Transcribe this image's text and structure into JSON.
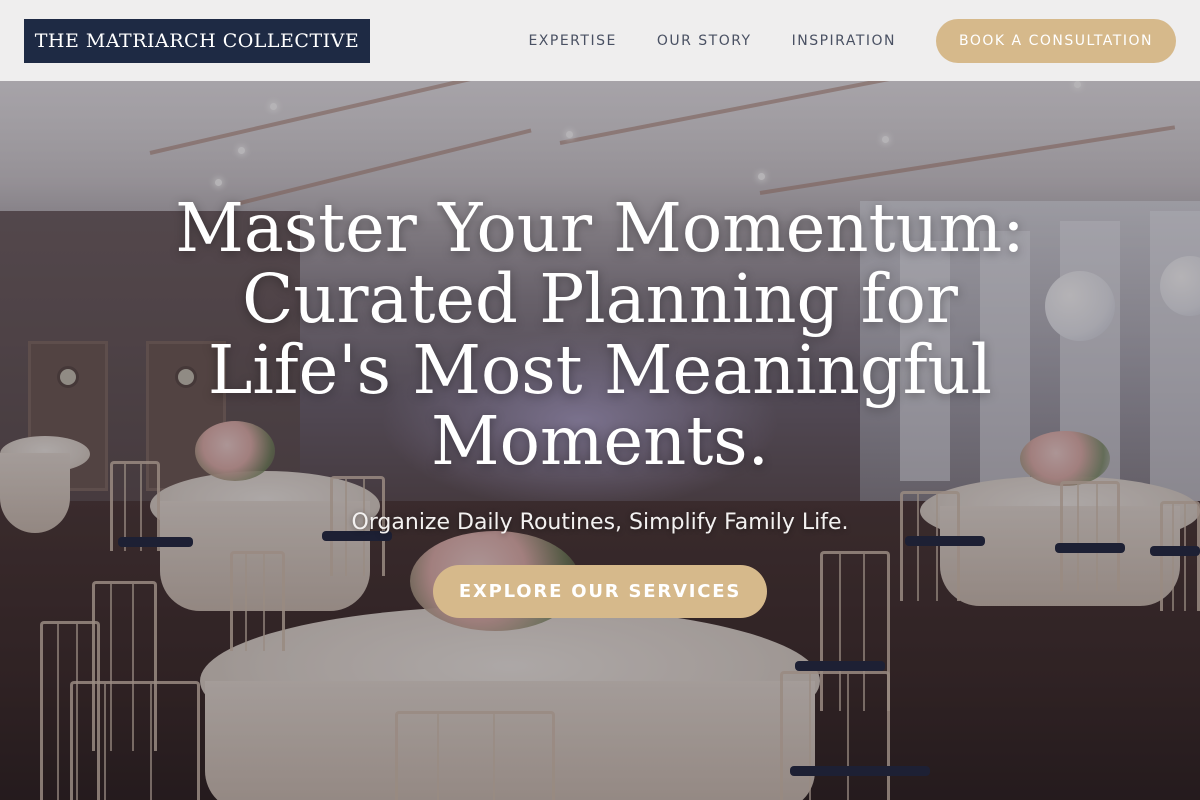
{
  "header": {
    "logo_text": "THE MATRIARCH COLLECTIVE",
    "nav": [
      {
        "label": "EXPERTISE"
      },
      {
        "label": "OUR STORY"
      },
      {
        "label": "INSPIRATION"
      }
    ],
    "cta_label": "BOOK A CONSULTATION"
  },
  "hero": {
    "headline": "Master Your Momentum: Curated Planning for Life's Most Meaningful Moments.",
    "subheadline": "Organize Daily Routines, Simplify Family Life.",
    "cta_label": "EXPLORE OUR SERVICES"
  },
  "colors": {
    "logo_background": "#1e2a44",
    "accent_gold": "#d6b98b",
    "nav_text": "#4a5163",
    "header_background": "#f5f5f5"
  }
}
